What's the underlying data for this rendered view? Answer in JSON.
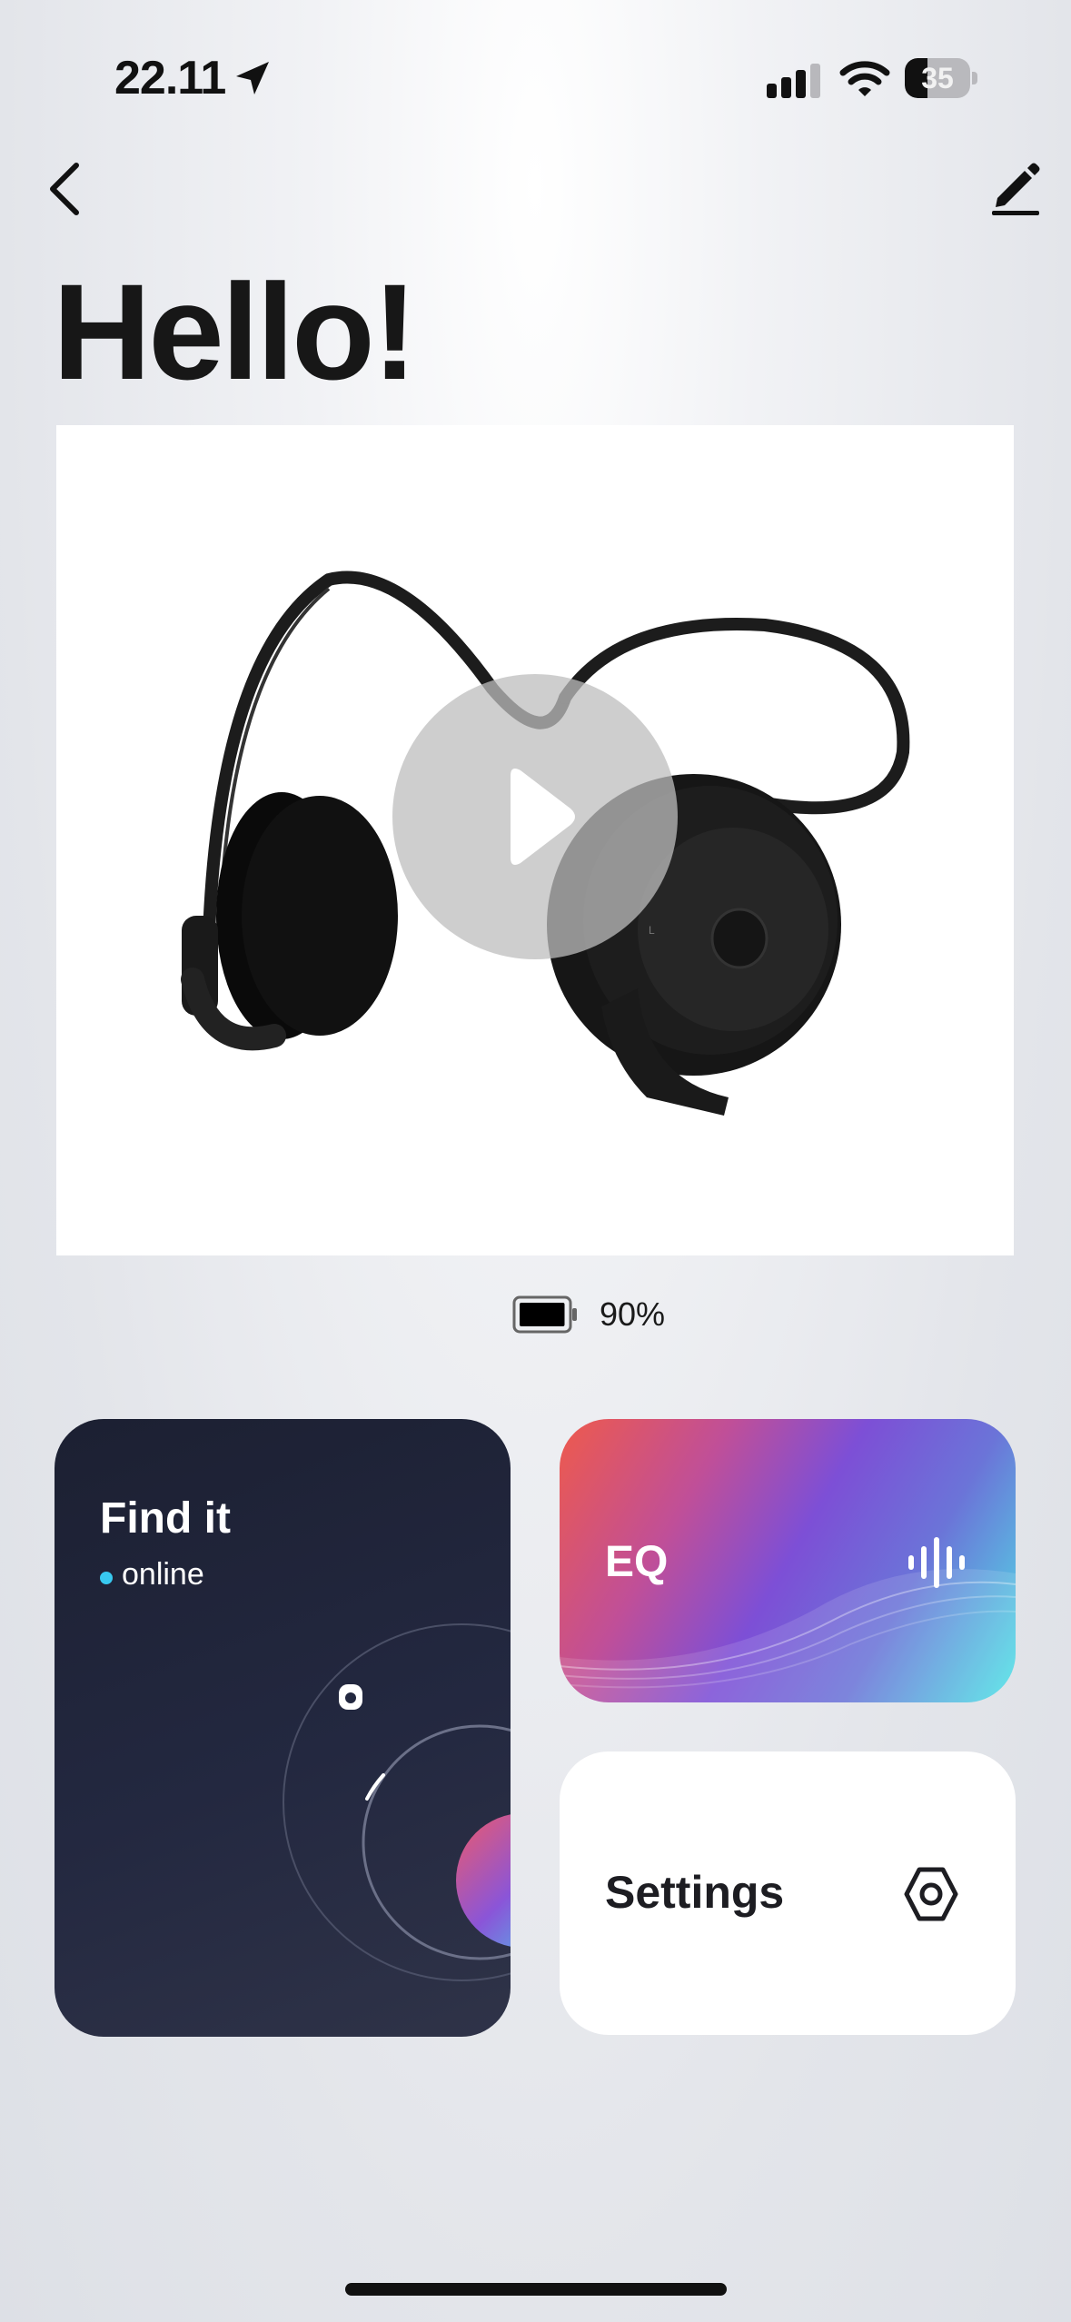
{
  "status_bar": {
    "time": "22.11",
    "battery_level": "35",
    "battery_fraction": 0.35,
    "icons": [
      "location-arrow-icon",
      "cellular-signal-icon",
      "wifi-icon",
      "battery-icon"
    ]
  },
  "nav": {
    "back_icon": "chevron-left-icon",
    "edit_icon": "pencil-icon"
  },
  "page": {
    "title": "Hello!"
  },
  "product": {
    "image": "headphones-image",
    "play_icon": "play-icon",
    "battery_percent_text": "90%",
    "battery_fraction": 0.9
  },
  "tiles": {
    "find_it": {
      "title": "Find it",
      "status": "online",
      "status_color": "#38c9f0"
    },
    "eq": {
      "title": "EQ",
      "icon": "sound-wave-icon"
    },
    "settings": {
      "title": "Settings",
      "icon": "gear-hexagon-icon"
    }
  }
}
